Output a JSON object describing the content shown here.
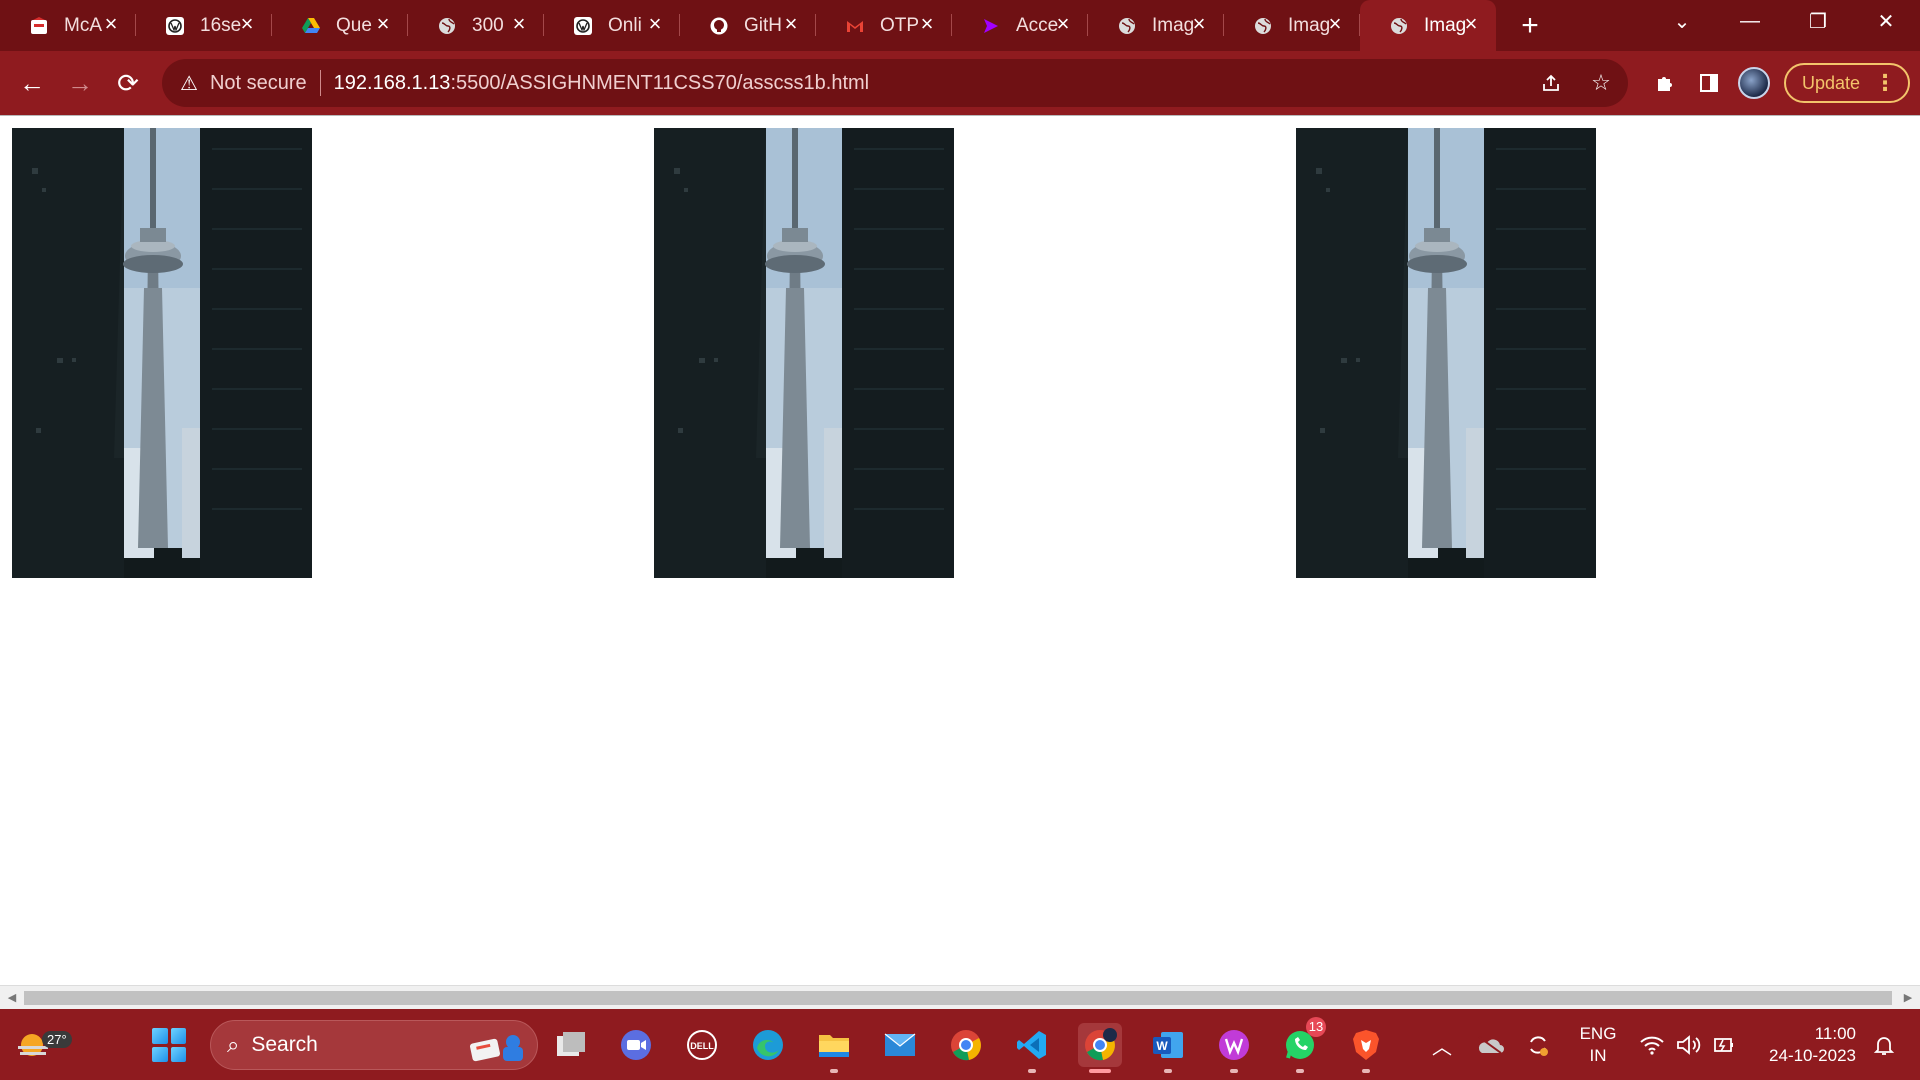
{
  "browser": {
    "tabs": [
      {
        "title": "McA",
        "icon": "mcafee-icon"
      },
      {
        "title": "16se",
        "icon": "wordpress-icon"
      },
      {
        "title": "Que",
        "icon": "google-drive-icon"
      },
      {
        "title": "300",
        "icon": "globe-icon"
      },
      {
        "title": "Onli",
        "icon": "wordpress-icon"
      },
      {
        "title": "GitH",
        "icon": "github-icon"
      },
      {
        "title": "OTP",
        "icon": "gmail-icon"
      },
      {
        "title": "Acce",
        "icon": "accenture-icon"
      },
      {
        "title": "Imag",
        "icon": "globe-icon"
      },
      {
        "title": "Imag",
        "icon": "globe-icon"
      },
      {
        "title": "Imag",
        "icon": "globe-icon",
        "active": true
      }
    ],
    "security_label": "Not secure",
    "url_host": "192.168.1.13",
    "url_path": ":5500/ASSIGHNMENT11CSS70/asscss1b.html",
    "update_label": "Update"
  },
  "page": {
    "images": [
      {
        "name": "CN Tower photo",
        "description": "tower-between-buildings"
      },
      {
        "name": "CN Tower photo",
        "description": "tower-between-buildings"
      },
      {
        "name": "CN Tower photo",
        "description": "tower-between-buildings"
      }
    ]
  },
  "taskbar": {
    "weather_temp": "27°",
    "search_label": "Search",
    "apps": [
      "file-explorer-icon",
      "zoom-icon",
      "dell-icon",
      "edge-icon",
      "folder-icon",
      "mail-icon",
      "chrome-icon",
      "vscode-icon",
      "chrome-canary-icon",
      "word-icon",
      "wps-icon",
      "whatsapp-icon",
      "brave-icon"
    ],
    "whatsapp_badge": "13",
    "lang_line1": "ENG",
    "lang_line2": "IN",
    "time": "11:00",
    "date": "24-10-2023"
  },
  "colors": {
    "tabstrip": "#6f1114",
    "toolbar": "#8f1b1f",
    "accent_update": "#f3c46b"
  }
}
